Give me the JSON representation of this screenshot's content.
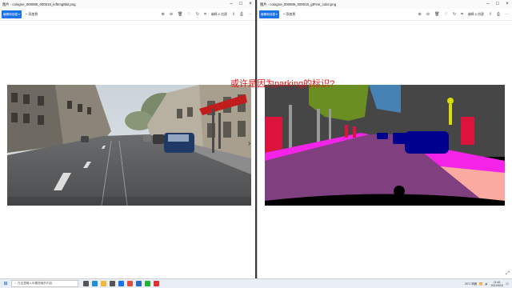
{
  "left_window": {
    "title": "图片 - cologne_000085_000019_leftImg8bit.png",
    "edit_button": "编辑和创建 ▾",
    "add_label": "添加到",
    "toolbar_edit": "编辑 & 创建"
  },
  "right_window": {
    "title": "图片 - cologne_000085_000019_gtFine_color.png",
    "edit_button": "编辑和创建 ▾",
    "add_label": "添加到",
    "toolbar_edit": "编辑 & 创建"
  },
  "annotation": {
    "text": "或许是因为parking的标识?",
    "color": "#e01818"
  },
  "taskbar": {
    "search_placeholder": "在这里输入你要搜索的内容",
    "tray_weather": "25°C 晴朗",
    "time": "11:45",
    "date": "2021/8/18"
  },
  "icons": {
    "window_controls": [
      "minimize-icon",
      "maximize-icon",
      "close-icon"
    ],
    "toolbar": [
      "zoom-in-icon",
      "zoom-out-icon",
      "delete-icon",
      "favorite-icon",
      "rotate-icon",
      "crop-icon",
      "share-icon",
      "print-icon",
      "more-icon"
    ]
  },
  "colors": {
    "accent": "#1a73e8",
    "road_segmentation": "#804080",
    "sidewalk_segmentation": "#f423e8",
    "car_segmentation": "#00008e",
    "vegetation_segmentation": "#6b8e23",
    "sky_segmentation": "#4682b4"
  }
}
